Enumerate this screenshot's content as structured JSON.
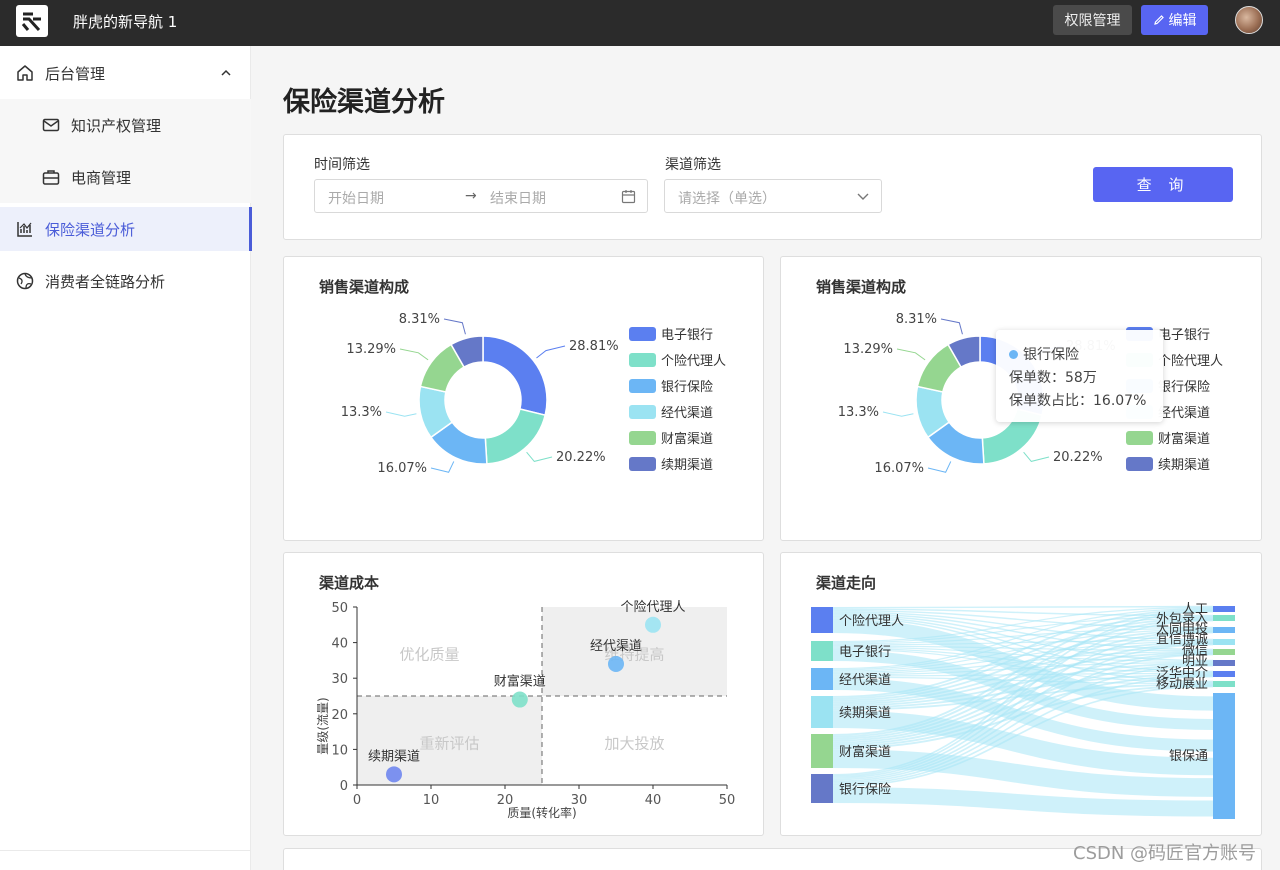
{
  "header": {
    "app_title": "胖虎的新导航 1",
    "perm_button": "权限管理",
    "edit_button": "编辑"
  },
  "sidebar": {
    "items": [
      {
        "label": "后台管理",
        "icon": "home-icon"
      },
      {
        "label": "知识产权管理",
        "icon": "mail-icon"
      },
      {
        "label": "电商管理",
        "icon": "briefcase-icon"
      },
      {
        "label": "保险渠道分析",
        "icon": "chart-icon"
      },
      {
        "label": "消费者全链路分析",
        "icon": "globe-icon"
      }
    ]
  },
  "page": {
    "title": "保险渠道分析"
  },
  "filters": {
    "time_label": "时间筛选",
    "start_placeholder": "开始日期",
    "arrow": "→",
    "end_placeholder": "结束日期",
    "channel_label": "渠道筛选",
    "channel_placeholder": "请选择（单选）",
    "query_button": "查 询"
  },
  "tooltip": {
    "name": "银行保险",
    "count_line": "保单数：58万",
    "ratio_line": "保单数占比：16.07%"
  },
  "watermark": "CSDN @码匠官方账号",
  "colors": {
    "accent": "#5865f2",
    "topbar": "#2b2b2b"
  },
  "chart_data": [
    {
      "type": "pie",
      "title": "销售渠道构成",
      "labels": [
        "电子银行",
        "个险代理人",
        "银行保险",
        "经代渠道",
        "财富渠道",
        "续期渠道"
      ],
      "values": [
        28.81,
        20.22,
        16.07,
        13.3,
        13.29,
        8.31
      ],
      "value_labels": [
        "28.81%",
        "20.22%",
        "16.07%",
        "13.3%",
        "13.29%",
        "8.31%"
      ],
      "colors": [
        "#5b7ff0",
        "#7ee0c9",
        "#6cb6f5",
        "#9be3f2",
        "#95d690",
        "#6578c8"
      ],
      "legend": "right"
    },
    {
      "type": "pie",
      "title": "销售渠道构成",
      "labels": [
        "电子银行",
        "个险代理人",
        "银行保险",
        "经代渠道",
        "财富渠道",
        "续期渠道"
      ],
      "values": [
        28.81,
        20.22,
        16.07,
        13.3,
        13.29,
        8.31
      ],
      "value_labels": [
        "28.81%",
        "20.22%",
        "16.07%",
        "13.3%",
        "13.29%",
        "8.31%"
      ],
      "colors": [
        "#5b7ff0",
        "#7ee0c9",
        "#6cb6f5",
        "#9be3f2",
        "#95d690",
        "#6578c8"
      ],
      "legend": "right"
    },
    {
      "type": "scatter",
      "title": "渠道成本",
      "xlabel": "质量(转化率)",
      "ylabel": "量级(流量)",
      "xlim": [
        0,
        50
      ],
      "ylim": [
        0,
        50
      ],
      "xticks": [
        0,
        10,
        20,
        30,
        40,
        50
      ],
      "yticks": [
        0,
        10,
        20,
        30,
        40,
        50
      ],
      "thresholds": {
        "x": 25,
        "y": 25
      },
      "quadrants": {
        "top_left": "优化质量",
        "top_right": "维持提高",
        "bottom_left": "重新评估",
        "bottom_right": "加大投放"
      },
      "points": [
        {
          "name": "续期渠道",
          "x": 5,
          "y": 3,
          "color": "#6f86ee"
        },
        {
          "name": "财富渠道",
          "x": 22,
          "y": 24,
          "color": "#7ee0c9"
        },
        {
          "name": "经代渠道",
          "x": 35,
          "y": 34,
          "color": "#6cb6f5"
        },
        {
          "name": "个险代理人",
          "x": 40,
          "y": 45,
          "color": "#9be3f2"
        }
      ]
    },
    {
      "type": "sankey",
      "title": "渠道走向",
      "sources": [
        {
          "name": "个险代理人",
          "color": "#5b7ff0"
        },
        {
          "name": "电子银行",
          "color": "#7ee0c9"
        },
        {
          "name": "经代渠道",
          "color": "#6cb6f5"
        },
        {
          "name": "续期渠道",
          "color": "#9be3f2"
        },
        {
          "name": "财富渠道",
          "color": "#95d690"
        },
        {
          "name": "银行保险",
          "color": "#6578c8"
        }
      ],
      "targets": [
        {
          "name": "人工",
          "color": "#5b7ff0"
        },
        {
          "name": "外包录入",
          "color": "#7ee0c9"
        },
        {
          "name": "大同申投",
          "color": "#6cb6f5"
        },
        {
          "name": "宜信博诚",
          "color": "#9be3f2"
        },
        {
          "name": "微信",
          "color": "#95d690"
        },
        {
          "name": "明亚",
          "color": "#6578c8"
        },
        {
          "name": "泛华中介",
          "color": "#5b7ff0"
        },
        {
          "name": "移动展业",
          "color": "#7ee0c9"
        },
        {
          "name": "银保通",
          "color": "#6cb6f5"
        }
      ]
    }
  ]
}
